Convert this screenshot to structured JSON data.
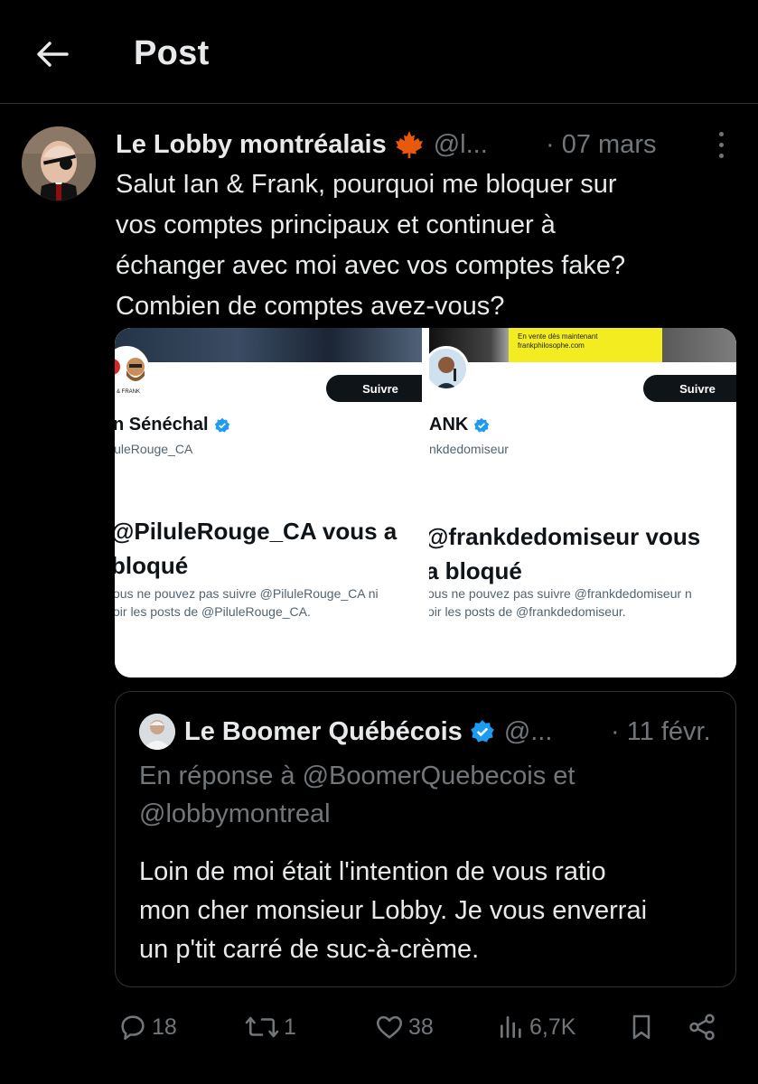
{
  "header": {
    "title": "Post"
  },
  "post": {
    "author_name": "Le Lobby montréalais",
    "handle": "@l...",
    "date": "· 07 mars",
    "text": "Salut Ian & Frank, pourquoi me bloquer sur\nvos comptes principaux et continuer à\néchanger avec moi avec vos comptes fake?\nCombien de comptes avez-vous?",
    "media": [
      {
        "follow_label": "Suivre",
        "name": "n Sénéchal",
        "handle": "luleRouge_CA",
        "blocked_title": "@PiluleRouge_CA vous a\nbloqué",
        "blocked_desc": "ous ne pouvez pas suivre @PiluleRouge_CA ni\noir les posts de @PiluleRouge_CA.",
        "avatar_caption": "& FRANK"
      },
      {
        "follow_label": "Suivre",
        "name": "ANK",
        "handle": "nkdedomiseur",
        "blocked_title": "@frankdedomiseur vous\na bloqué",
        "blocked_desc": "ous ne pouvez pas suivre @frankdedomiseur n\noir les posts de @frankdedomiseur.",
        "banner_line1": "En vente dès maintenant",
        "banner_line2": "frankphilosophe.com"
      }
    ]
  },
  "quoted": {
    "author_name": "Le Boomer Québécois",
    "handle": "@...",
    "date": "· 11 févr.",
    "reply_to": "En réponse à @BoomerQuebecois et\n@lobbymontreal",
    "text": "Loin de moi était l'intention de vous ratio\nmon cher monsieur Lobby. Je vous enverrai\nun p'tit carré de suc-à-crème."
  },
  "actions": {
    "replies": "18",
    "reposts": "1",
    "likes": "38",
    "views": "6,7K"
  },
  "colors": {
    "background": "#000000",
    "text": "#e7e9ea",
    "muted": "#71767b",
    "border": "#2f3336",
    "verified": "#1d9bf0",
    "maple": "#e8590c"
  }
}
